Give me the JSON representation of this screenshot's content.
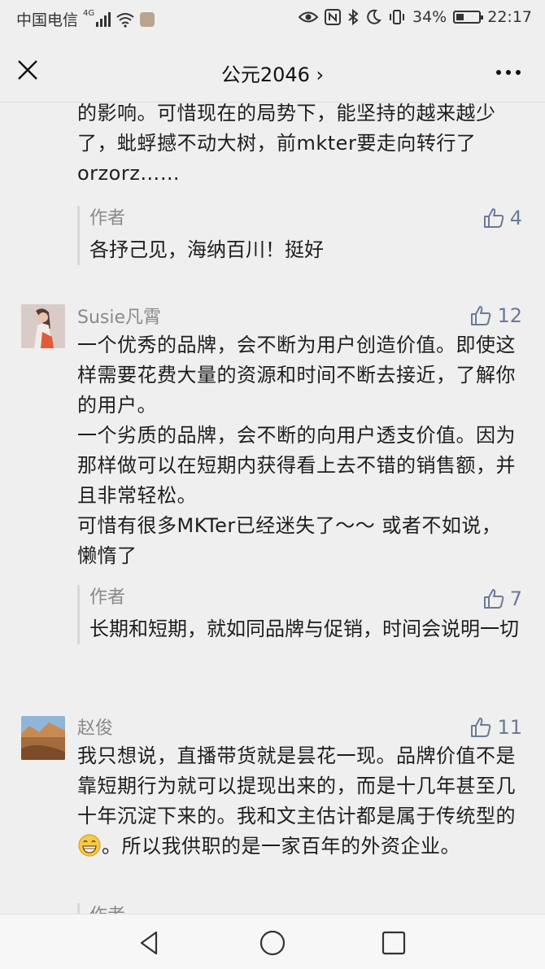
{
  "status": {
    "carrier": "中国电信",
    "network": "4G",
    "battery": "34%",
    "battery_level": 0.34,
    "time": "22:17",
    "icons": [
      "eye-icon",
      "nfc-icon",
      "bluetooth-icon",
      "moon-icon",
      "vibrate-icon",
      "battery-icon"
    ]
  },
  "nav": {
    "title": "公元2046",
    "title_chevron": "›"
  },
  "comments": [
    {
      "text_tail": "的影响。可惜现在的局势下，能坚持的越来越少了，蚍蜉撼不动大树，前mkter要走向转行了orzorz……",
      "reply": {
        "author": "作者",
        "text": "各抒己见，海纳百川！挺好",
        "likes": "4"
      }
    },
    {
      "user": "Susie凡霄",
      "likes": "12",
      "text": "一个优秀的品牌，会不断为用户创造价值。即使这样需要花费大量的资源和时间不断去接近，了解你的用户。\n一个劣质的品牌，会不断的向用户透支价值。因为那样做可以在短期内获得看上去不错的销售额，并且非常轻松。\n可惜有很多MKTer已经迷失了～～ 或者不如说，懒惰了",
      "reply": {
        "author": "作者",
        "text": "长期和短期，就如同品牌与促销，时间会说明一切",
        "likes": "7"
      }
    },
    {
      "user": "赵俊",
      "likes": "11",
      "text_before_emoji": "我只想说，直播带货就是昙花一现。品牌价值不是靠短期行为就可以提现出来的，而是十几年甚至几十年沉淀下来的。我和文主估计都是属于传统型的",
      "emoji": "grin-emoji",
      "text_after_emoji": "。所以我供职的是一家百年的外资企业。",
      "reply_author_partial": "作者"
    }
  ]
}
